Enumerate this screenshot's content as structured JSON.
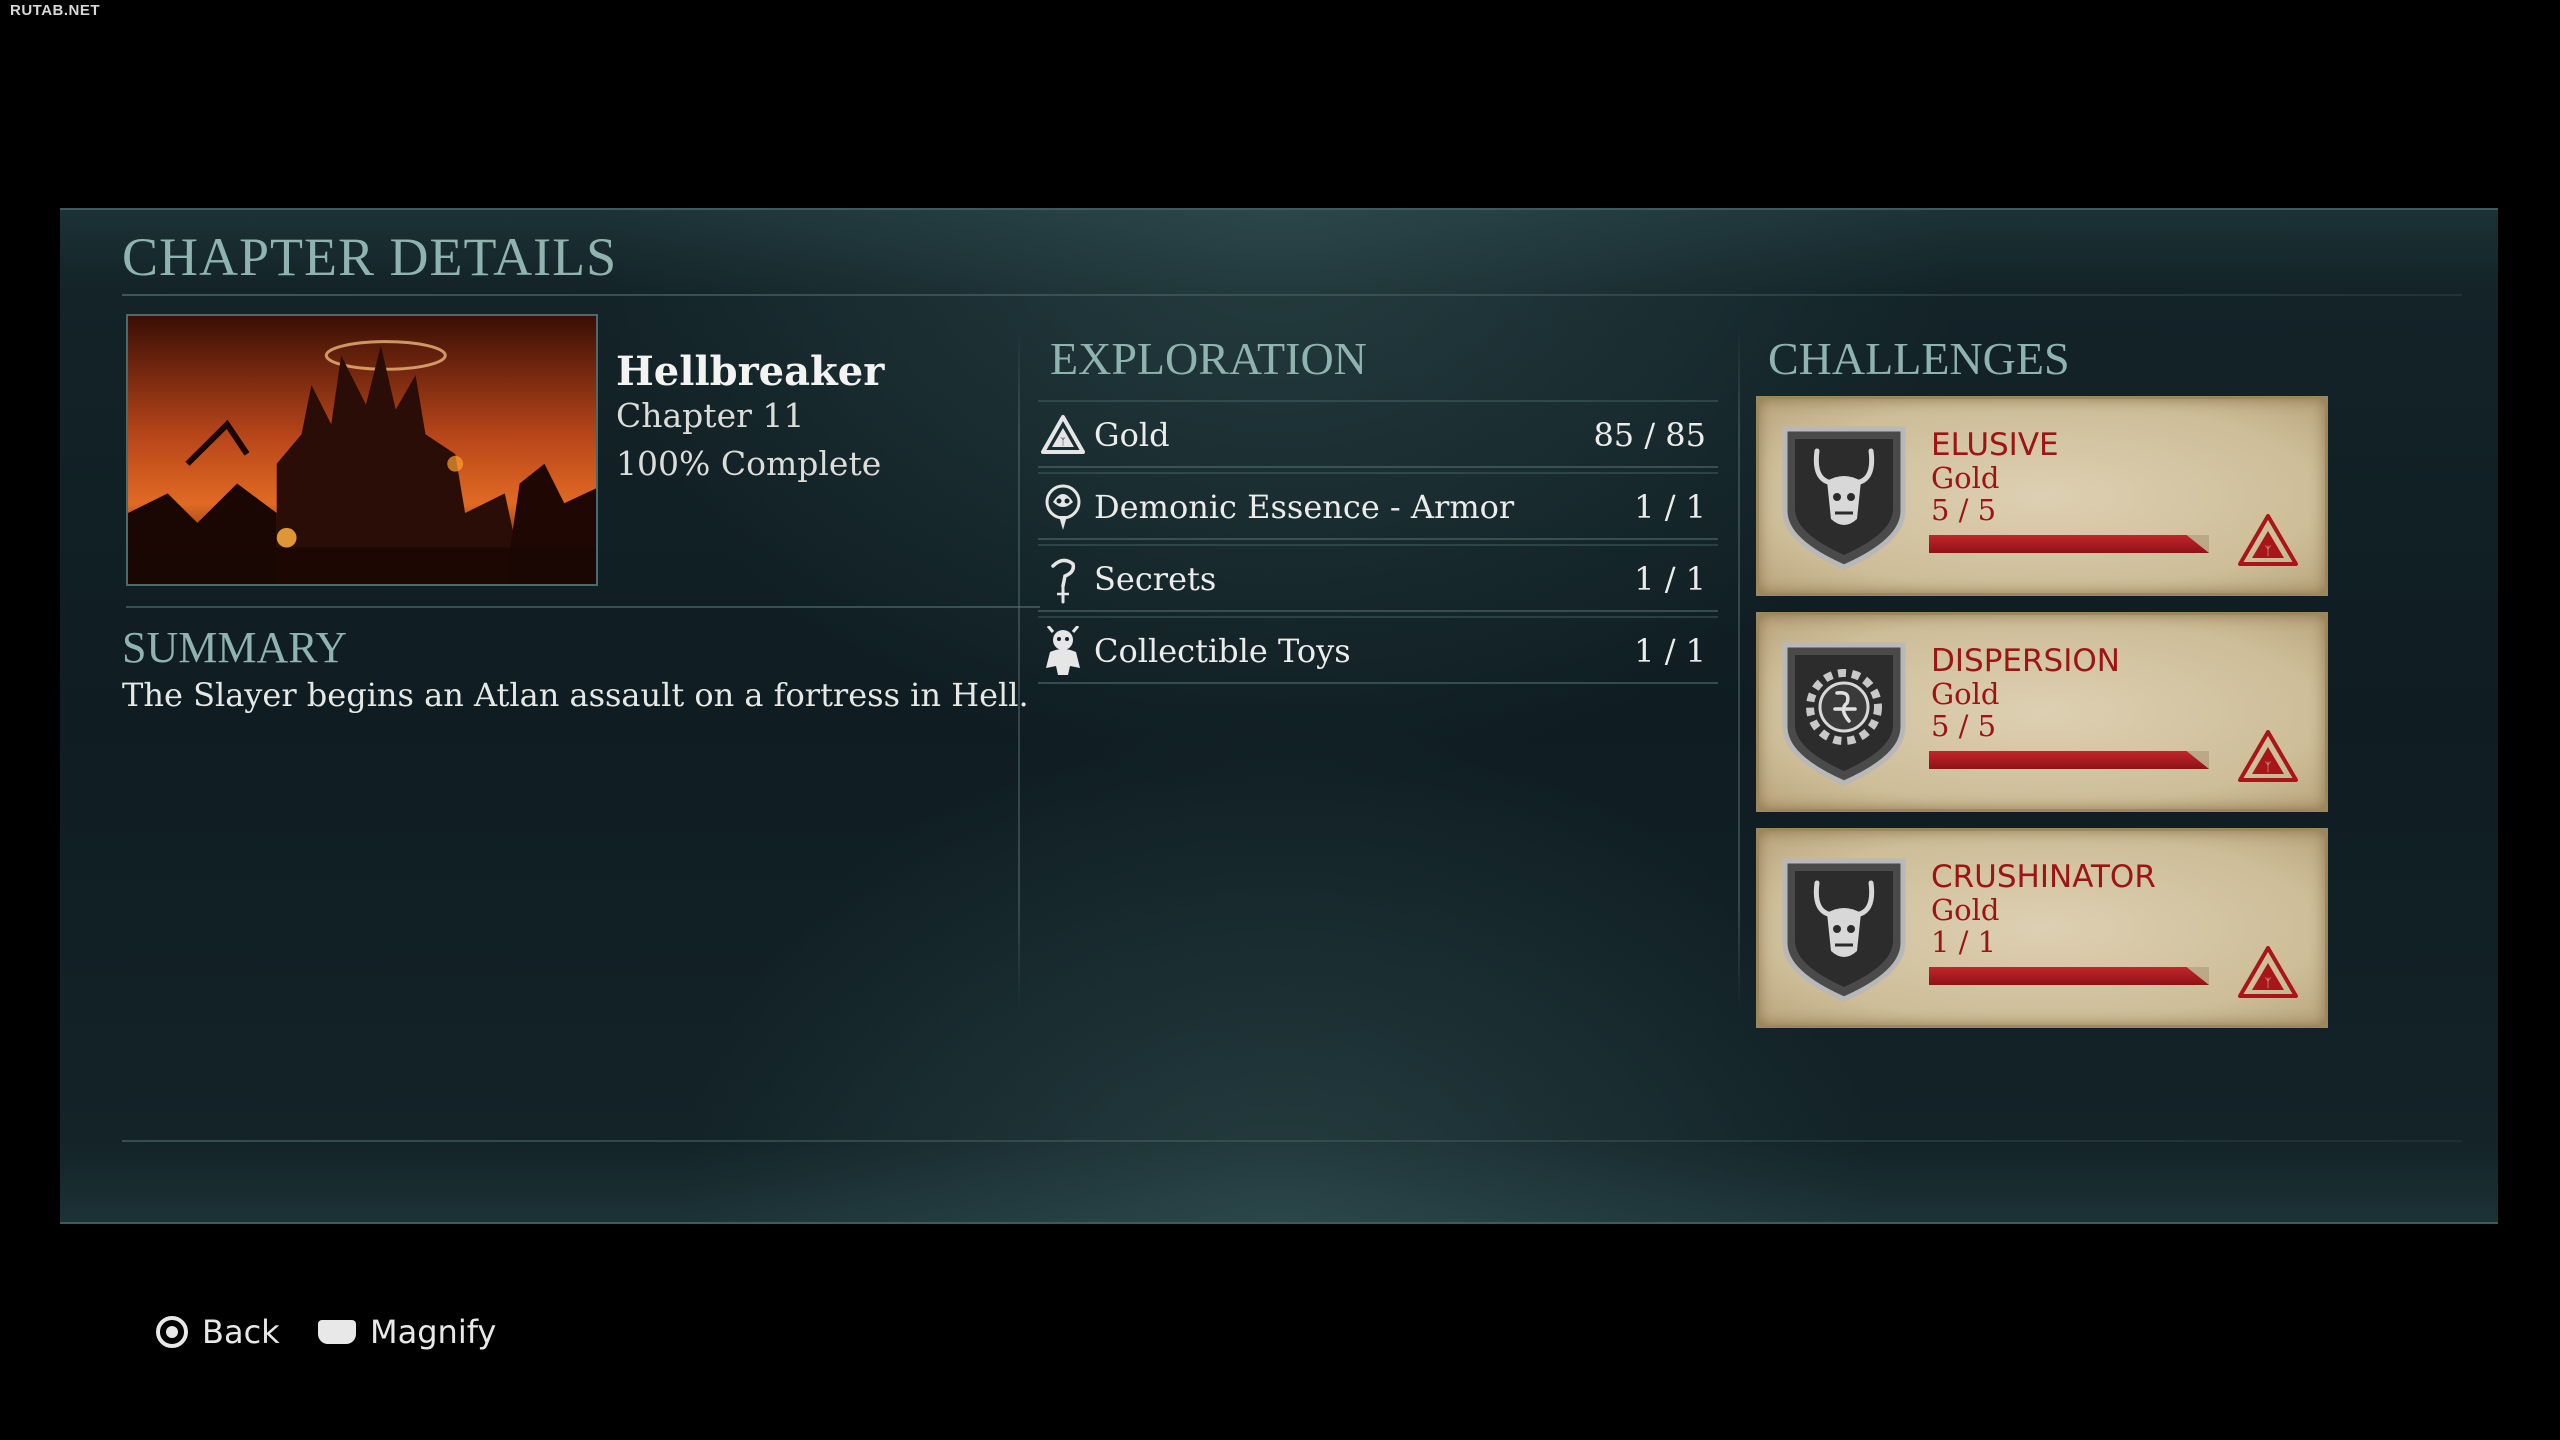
{
  "watermark": "RUTAB.NET",
  "panel_title": "CHAPTER DETAILS",
  "chapter": {
    "name": "Hellbreaker",
    "number": "Chapter 11",
    "completion": "100% Complete",
    "image_icon": "hellfire-fortress-thumbnail"
  },
  "summary": {
    "title": "SUMMARY",
    "text": "The Slayer begins an Atlan assault on a fortress in Hell."
  },
  "exploration": {
    "title": "EXPLORATION",
    "rows": [
      {
        "icon": "gold-triangle-icon",
        "label": "Gold",
        "value": "85 / 85"
      },
      {
        "icon": "demonic-essence-icon",
        "label": "Demonic Essence - Armor",
        "value": "1 / 1"
      },
      {
        "icon": "secret-icon",
        "label": "Secrets",
        "value": "1 / 1"
      },
      {
        "icon": "toy-icon",
        "label": "Collectible Toys",
        "value": "1 / 1"
      }
    ]
  },
  "challenges": {
    "title": "CHALLENGES",
    "items": [
      {
        "name": "ELUSIVE",
        "tier": "Gold",
        "count": "5 / 5",
        "progress": 1.0,
        "badge": "demon-skull-badge"
      },
      {
        "name": "DISPERSION",
        "tier": "Gold",
        "count": "5 / 5",
        "progress": 1.0,
        "badge": "cog-rune-badge"
      },
      {
        "name": "CRUSHINATOR",
        "tier": "Gold",
        "count": "1 / 1",
        "progress": 1.0,
        "badge": "demon-skull-badge"
      }
    ]
  },
  "footer": {
    "back_label": "Back",
    "magnify_label": "Magnify"
  },
  "colors": {
    "accent_teal": "#8fb4b0",
    "challenge_red": "#9c1414",
    "parchment": "#d6c8a6"
  }
}
